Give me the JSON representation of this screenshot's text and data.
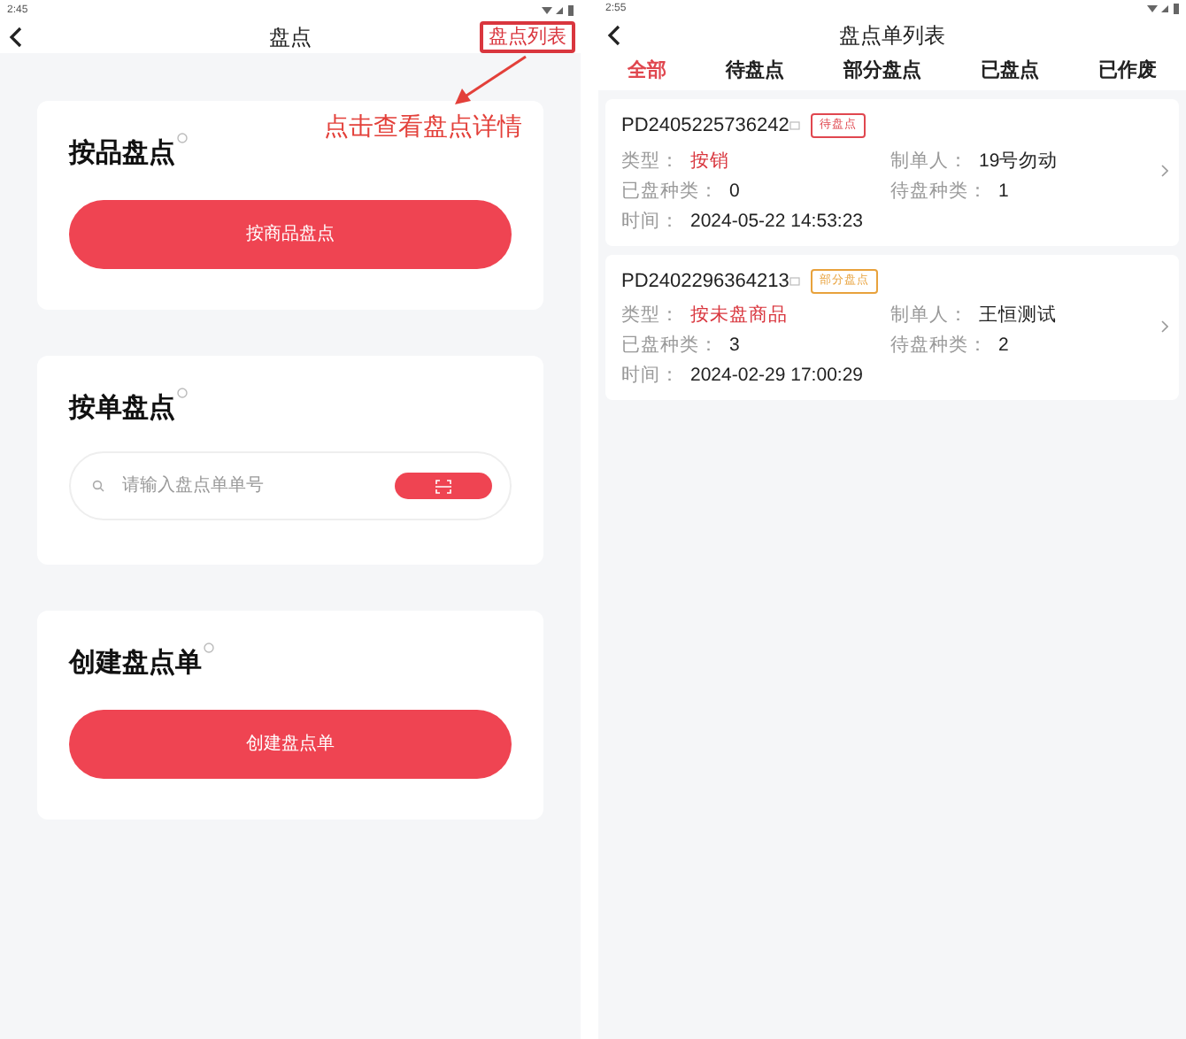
{
  "left_screen": {
    "status_bar": {
      "time": "2:45"
    },
    "header": {
      "title": "盘点",
      "action": "盘点列表"
    },
    "annotation": {
      "text": "点击查看盘点详情"
    },
    "sections": [
      {
        "kind": "button",
        "title": "按品盘点",
        "button": "按商品盘点"
      },
      {
        "kind": "search",
        "title": "按单盘点",
        "placeholder": "请输入盘点单单号"
      },
      {
        "kind": "button",
        "title": "创建盘点单",
        "button": "创建盘点单"
      }
    ]
  },
  "right_screen": {
    "status_bar": {
      "time": "2:55"
    },
    "header": {
      "title": "盘点单列表"
    },
    "tabs": [
      {
        "label": "全部",
        "selected": true
      },
      {
        "label": "待盘点",
        "selected": false
      },
      {
        "label": "部分盘点",
        "selected": false
      },
      {
        "label": "已盘点",
        "selected": false
      },
      {
        "label": "已作废",
        "selected": false
      }
    ],
    "orders": [
      {
        "number": "PD2405225736242",
        "status": "待盘点",
        "color": "#e0474f",
        "fields": [
          {
            "label": "类型：",
            "value": "按销",
            "accent": true
          },
          {
            "label": "制单人：",
            "value": "19号勿动",
            "accent": false
          },
          {
            "label": "已盘种类：",
            "value": "0",
            "accent": false
          },
          {
            "label": "待盘种类：",
            "value": "1",
            "accent": false
          },
          {
            "label": "时间：",
            "value": "2024-05-22 14:53:23",
            "accent": false
          }
        ]
      },
      {
        "number": "PD2402296364213",
        "status": "部分盘点",
        "color": "#e8a23c",
        "fields": [
          {
            "label": "类型：",
            "value": "按未盘商品",
            "accent": true
          },
          {
            "label": "制单人：",
            "value": "王恒测试",
            "accent": false
          },
          {
            "label": "已盘种类：",
            "value": "3",
            "accent": false
          },
          {
            "label": "待盘种类：",
            "value": "2",
            "accent": false
          },
          {
            "label": "时间：",
            "value": "2024-02-29 17:00:29",
            "accent": false
          }
        ]
      }
    ]
  }
}
